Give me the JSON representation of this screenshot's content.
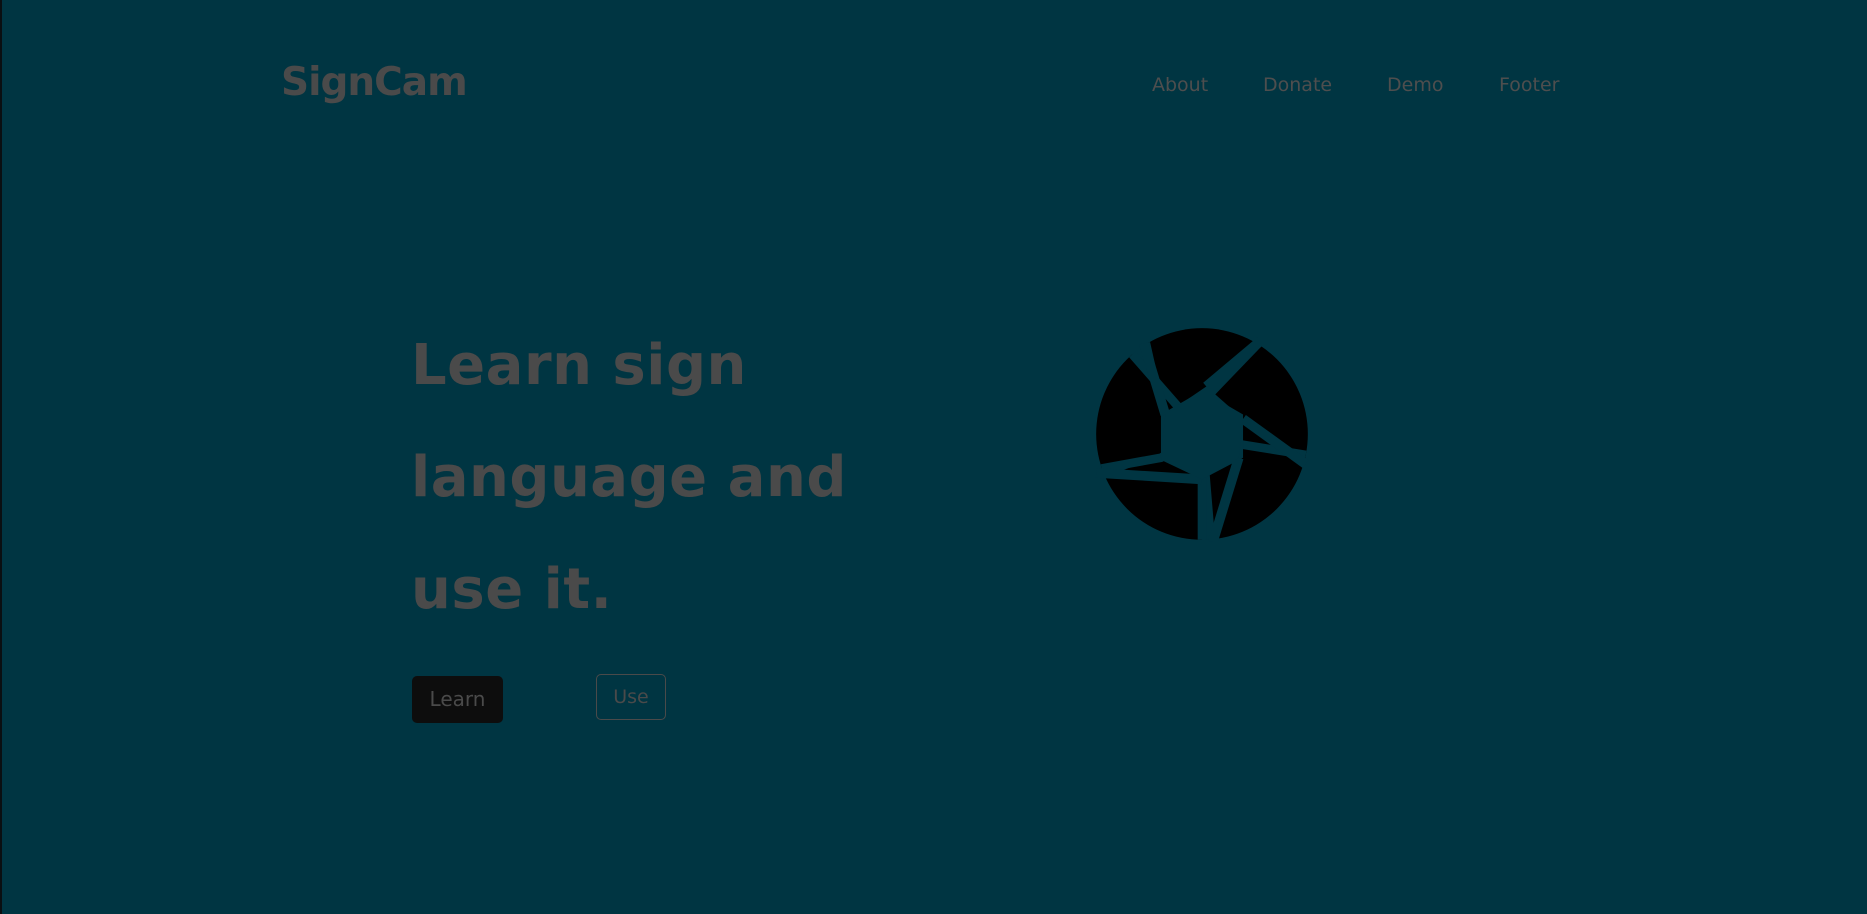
{
  "header": {
    "logo": "SignCam",
    "nav": [
      "About",
      "Donate",
      "Demo",
      "Footer"
    ]
  },
  "hero": {
    "title_lines": [
      "Learn sign",
      "language and",
      "use it."
    ],
    "buttons": {
      "learn": "Learn",
      "use": "Use"
    }
  },
  "icons": {
    "hero_image": "camera-aperture-icon"
  },
  "colors": {
    "background": "#003542",
    "text": "#4a4a4a",
    "primary_button": "#0d0d0d",
    "icon": "#000000"
  }
}
